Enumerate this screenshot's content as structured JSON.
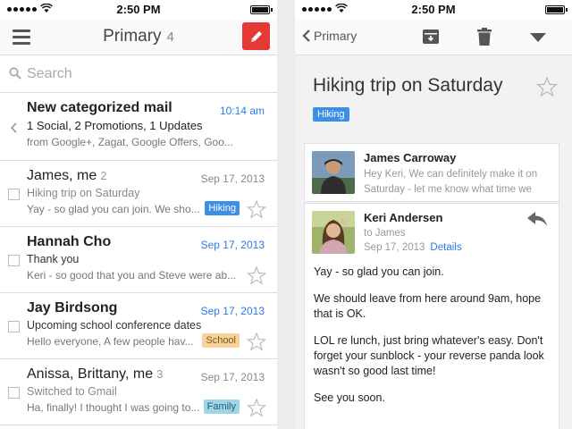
{
  "left": {
    "status": {
      "time": "2:50 PM"
    },
    "header": {
      "title": "Primary",
      "count": "4"
    },
    "search": {
      "placeholder": "Search"
    },
    "mails": [
      {
        "from": "New categorized mail",
        "date": "10:14 am",
        "subject": "1 Social, 2 Promotions, 1 Updates",
        "snippet": "from Google+, Zagat, Google Offers, Goo..."
      },
      {
        "from": "James, me",
        "thread_count": "2",
        "date": "Sep 17, 2013",
        "subject": "Hiking trip on Saturday",
        "snippet": "Yay - so glad you can join. We sho...",
        "label": "Hiking"
      },
      {
        "from": "Hannah Cho",
        "date": "Sep 17, 2013",
        "subject": "Thank you",
        "snippet": "Keri - so good that you and Steve were ab..."
      },
      {
        "from": "Jay Birdsong",
        "date": "Sep 17, 2013",
        "subject": "Upcoming school conference dates",
        "snippet": "Hello everyone, A few people hav...",
        "label": "School"
      },
      {
        "from": "Anissa, Brittany, me",
        "thread_count": "3",
        "date": "Sep 17, 2013",
        "subject": "Switched to Gmail",
        "snippet": "Ha, finally! I thought I was going to...",
        "label": "Family"
      }
    ]
  },
  "right": {
    "status": {
      "time": "2:50 PM"
    },
    "header": {
      "back_label": "Primary"
    },
    "thread": {
      "title": "Hiking trip on Saturday",
      "label": "Hiking"
    },
    "messages": [
      {
        "sender": "James Carroway",
        "preview": "Hey Keri, We can definitely make it on Saturday - let me know what time we"
      },
      {
        "sender": "Keri Andersen",
        "to": "to James",
        "date": "Sep 17, 2013",
        "details_link": "Details",
        "body": [
          "Yay - so glad you can join.",
          "We should leave from here around 9am, hope that is OK.",
          "LOL re lunch, just bring whatever's easy. Don't forget your sunblock - your reverse panda look wasn't so good last time!",
          "See you soon."
        ]
      }
    ]
  },
  "colors": {
    "compose": "#e53935",
    "link_blue": "#2a7be4",
    "hiking": "#3d8fe6",
    "school": "#f9d29a",
    "family": "#9fd5e8"
  },
  "icons": [
    "hamburger-icon",
    "compose-pencil-icon",
    "search-icon",
    "chevron-left-icon",
    "star-icon",
    "archive-icon",
    "trash-icon",
    "dropdown-triangle-icon",
    "reply-icon"
  ]
}
